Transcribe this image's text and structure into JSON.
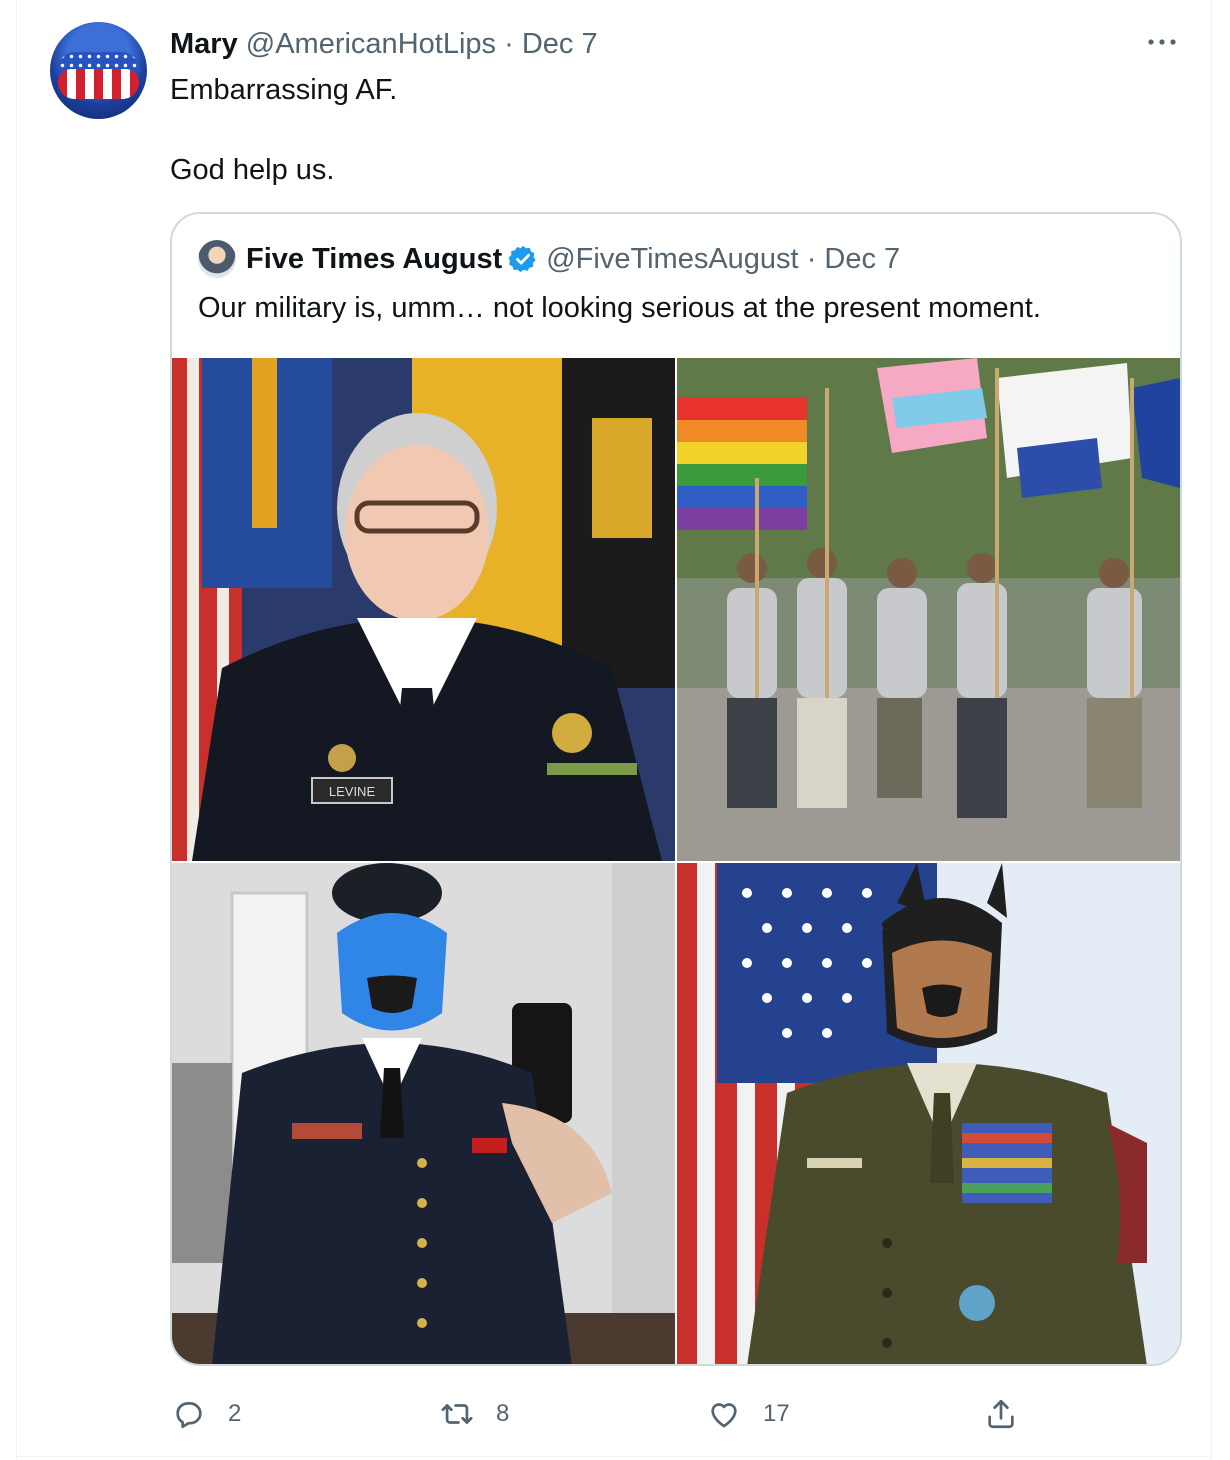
{
  "tweet": {
    "author_name": "Mary",
    "author_handle": "@AmericanHotLips",
    "separator": "·",
    "date": "Dec 7",
    "text_line1": "Embarrassing AF.",
    "text_line2": "God help us.",
    "more_icon": "more-horizontal-icon"
  },
  "quoted": {
    "author_name": "Five Times August",
    "verified_icon": "verified-badge-icon",
    "author_handle": "@FiveTimesAugust",
    "separator": "·",
    "date": "Dec 7",
    "text": "Our military is, umm… not looking serious at the present moment.",
    "media": [
      {
        "badge": "LEVINE"
      },
      {},
      {},
      {}
    ]
  },
  "actions": {
    "reply": {
      "icon": "reply-icon",
      "count": "2"
    },
    "retweet": {
      "icon": "retweet-icon",
      "count": "8"
    },
    "like": {
      "icon": "heart-icon",
      "count": "17"
    },
    "share": {
      "icon": "share-icon"
    }
  },
  "colors": {
    "text": "#0f1419",
    "muted": "#536471",
    "border": "#cfd9de",
    "verified": "#1d9bf0"
  }
}
